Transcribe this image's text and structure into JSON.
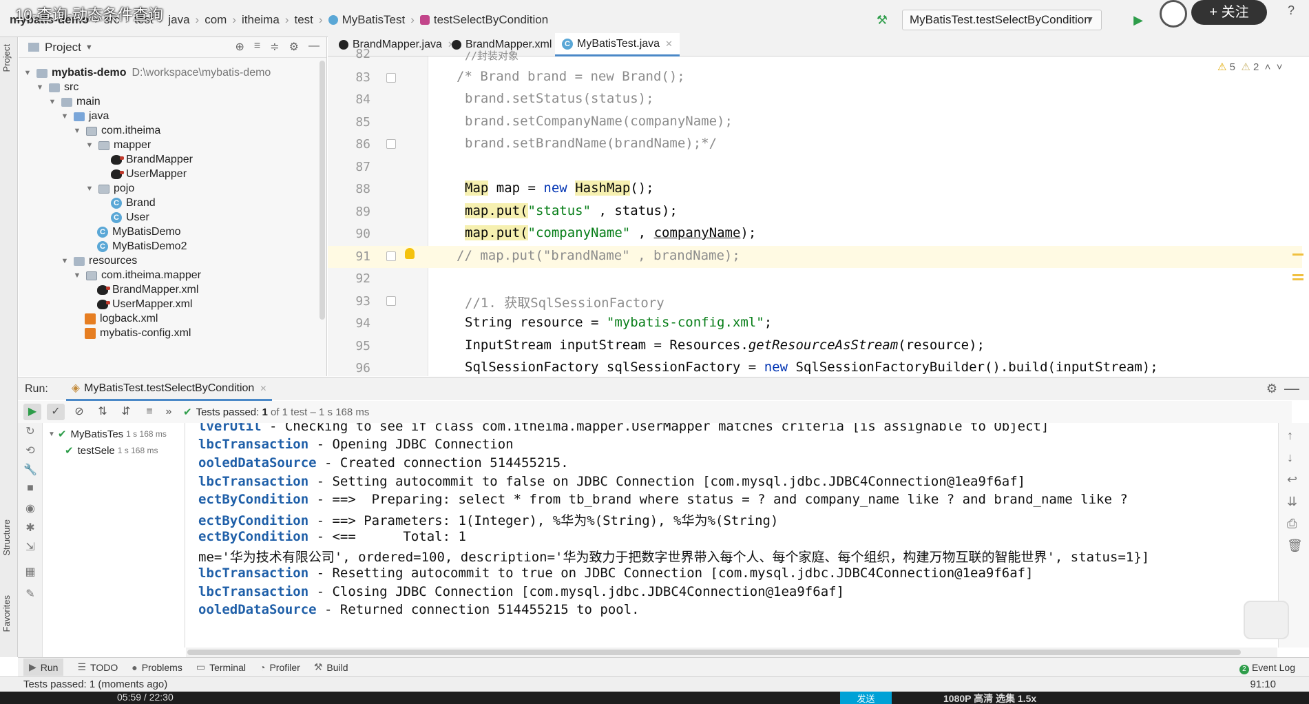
{
  "video_title": "10-查询-动态条件查询",
  "breadcrumbs": [
    "mybatis-demo",
    "src",
    "test",
    "java",
    "com",
    "itheima",
    "test",
    "MyBatisTest",
    "testSelectByCondition"
  ],
  "run_config": "MyBatisTest.testSelectByCondition",
  "follow_label": "+ 关注",
  "project": {
    "title": "Project",
    "items": [
      {
        "label": "mybatis-demo",
        "path": "D:\\workspace\\mybatis-demo"
      },
      {
        "label": "src"
      },
      {
        "label": "main"
      },
      {
        "label": "java"
      },
      {
        "label": "com.itheima"
      },
      {
        "label": "mapper"
      },
      {
        "label": "BrandMapper"
      },
      {
        "label": "UserMapper"
      },
      {
        "label": "pojo"
      },
      {
        "label": "Brand"
      },
      {
        "label": "User"
      },
      {
        "label": "MyBatisDemo"
      },
      {
        "label": "MyBatisDemo2"
      },
      {
        "label": "resources"
      },
      {
        "label": "com.itheima.mapper"
      },
      {
        "label": "BrandMapper.xml"
      },
      {
        "label": "UserMapper.xml"
      },
      {
        "label": "logback.xml"
      },
      {
        "label": "mybatis-config.xml"
      }
    ]
  },
  "editor": {
    "tabs": [
      "BrandMapper.java",
      "BrandMapper.xml",
      "MyBatisTest.java"
    ],
    "warnings": "5",
    "weak_warnings": "2",
    "line_numbers": [
      "82",
      "83",
      "84",
      "85",
      "86",
      "87",
      "88",
      "89",
      "90",
      "91",
      "92",
      "93",
      "94",
      "95",
      "96"
    ],
    "lines": {
      "l82": "//封装对象",
      "l83": "/* Brand brand = new Brand();",
      "l84": "brand.setStatus(status);",
      "l85": "brand.setCompanyName(companyName);",
      "l86": "brand.setBrandName(brandName);*/",
      "l88_type": "Map",
      "l88_mid": " map = ",
      "l88_new": "new",
      "l88_cls": "HashMap",
      "l88_end": "();",
      "l89_a": "map.put(",
      "l89_s": "\"status\"",
      "l89_b": " , status);",
      "l90_a": "map.put(",
      "l90_s": "\"companyName\"",
      "l90_b": " , ",
      "l90_v": "companyName",
      "l90_c": ");",
      "l91": "// map.put(\"brandName\" , brandName);",
      "l93": "//1. 获取SqlSessionFactory",
      "l94_a": "String resource = ",
      "l94_s": "\"mybatis-config.xml\"",
      "l94_b": ";",
      "l95_a": "InputStream inputStream = Resources.",
      "l95_m": "getResourceAsStream",
      "l95_b": "(resource);",
      "l96_a": "SqlSessionFactory sqlSessionFactory = ",
      "l96_new": "new",
      "l96_b": " SqlSessionFactoryBuilder().build(inputStream);"
    }
  },
  "run": {
    "label": "Run:",
    "tab": "MyBatisTest.testSelectByCondition",
    "passed_label": "Tests passed:",
    "passed_count": "1",
    "passed_detail": "of 1 test – 1 s 168 ms",
    "tree": [
      {
        "name": "MyBatisTes",
        "time": "1 s 168 ms"
      },
      {
        "name": "testSele",
        "time": "1 s 168 ms"
      }
    ],
    "console": [
      {
        "logger": "lverUtil",
        "msg": " - Checking to see if class com.itheima.mapper.UserMapper matches criteria [is assignable to Object]"
      },
      {
        "logger": "lbcTransaction",
        "msg": " - Opening JDBC Connection"
      },
      {
        "logger": "ooledDataSource",
        "msg": " - Created connection 514455215."
      },
      {
        "logger": "lbcTransaction",
        "msg": " - Setting autocommit to false on JDBC Connection [com.mysql.jdbc.JDBC4Connection@1ea9f6af]"
      },
      {
        "logger": "ectByCondition",
        "msg": " - ==>  Preparing: select * from tb_brand where status = ? and company_name like ? and brand_name like ?"
      },
      {
        "logger": "ectByCondition",
        "msg": " - ==> Parameters: 1(Integer), %华为%(String), %华为%(String)"
      },
      {
        "logger": "ectByCondition",
        "msg": " - <==      Total: 1"
      },
      {
        "logger": "",
        "msg": "me='华为技术有限公司', ordered=100, description='华为致力于把数字世界带入每个人、每个家庭、每个组织，构建万物互联的智能世界', status=1}]"
      },
      {
        "logger": "lbcTransaction",
        "msg": " - Resetting autocommit to true on JDBC Connection [com.mysql.jdbc.JDBC4Connection@1ea9f6af]"
      },
      {
        "logger": "lbcTransaction",
        "msg": " - Closing JDBC Connection [com.mysql.jdbc.JDBC4Connection@1ea9f6af]"
      },
      {
        "logger": "ooledDataSource",
        "msg": " - Returned connection 514455215 to pool."
      }
    ]
  },
  "bottom_tabs": [
    "Run",
    "TODO",
    "Problems",
    "Terminal",
    "Profiler",
    "Build"
  ],
  "event_log": "Event Log",
  "event_count": "2",
  "side_labels": {
    "project": "Project",
    "structure": "Structure",
    "favorites": "Favorites"
  },
  "status": {
    "message": "Tests passed: 1 (moments ago)",
    "position": "91:10"
  },
  "player": {
    "time": "05:59 / 22:30",
    "send": "发送",
    "right": "1080P 高清   选集   1.5x"
  },
  "colors": {
    "accent": "#4a88c7",
    "pass": "#2e9d4a",
    "keyword": "#0033b3",
    "string": "#067d17",
    "comment": "#8c8c8c"
  }
}
